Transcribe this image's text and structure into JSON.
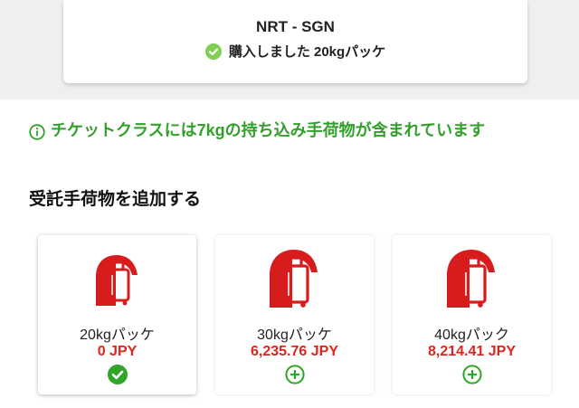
{
  "flight": {
    "route": "NRT - SGN",
    "purchased_text": "購入しました 20kgパッケ"
  },
  "notice": {
    "text": "チケットクラスには7kgの持ち込み手荷物が含まれています"
  },
  "section": {
    "title": "受託手荷物を追加する"
  },
  "options": [
    {
      "name": "20kgパッケ",
      "price": "0 JPY",
      "state": "selected",
      "state_icon": "check-circle-icon"
    },
    {
      "name": "30kgパッケ",
      "price": "6,235.76 JPY",
      "state": "add",
      "state_icon": "plus-circle-icon"
    },
    {
      "name": "40kgパック",
      "price": "8,214.41 JPY",
      "state": "add",
      "state_icon": "plus-circle-icon"
    }
  ],
  "colors": {
    "accent_green": "#33a02c",
    "check_green": "#2fa52a",
    "price_red": "#e0231c",
    "bag_red": "#d61c1c"
  }
}
